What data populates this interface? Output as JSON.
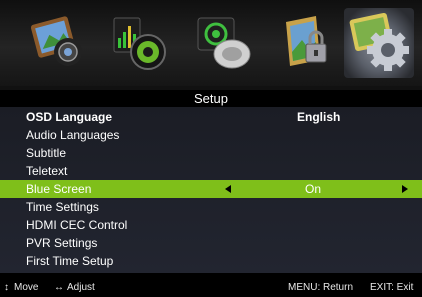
{
  "icons": [
    {
      "name": "picture-icon"
    },
    {
      "name": "sound-icon"
    },
    {
      "name": "channel-icon"
    },
    {
      "name": "lock-icon"
    },
    {
      "name": "setup-gear-icon"
    }
  ],
  "title": "Setup",
  "menu": {
    "items": [
      {
        "label": "OSD Language",
        "value": "English"
      },
      {
        "label": "Audio Languages",
        "value": ""
      },
      {
        "label": "Subtitle",
        "value": ""
      },
      {
        "label": "Teletext",
        "value": ""
      },
      {
        "label": "Blue Screen",
        "value": "On"
      },
      {
        "label": "Time Settings",
        "value": ""
      },
      {
        "label": "HDMI CEC Control",
        "value": ""
      },
      {
        "label": "PVR Settings",
        "value": ""
      },
      {
        "label": "First Time Setup",
        "value": ""
      }
    ]
  },
  "footer": {
    "move_glyph": "↕",
    "move_label": "Move",
    "adjust_glyph": "↔",
    "adjust_label": "Adjust",
    "menu_hint": "MENU: Return",
    "exit_hint": "EXIT: Exit"
  },
  "colors": {
    "highlight": "#7fbf1a",
    "menu_bg": "#1f2129"
  }
}
